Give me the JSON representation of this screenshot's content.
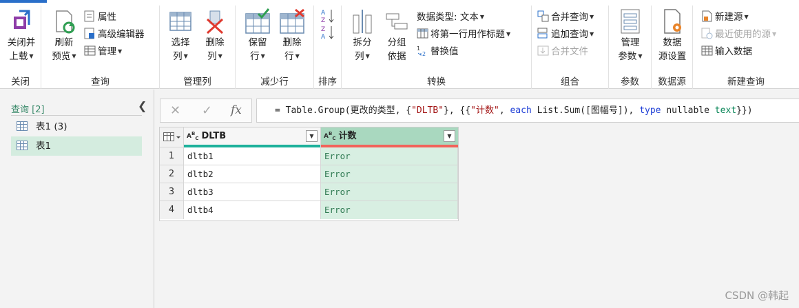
{
  "ribbon": {
    "groups": {
      "close": {
        "label": "关闭",
        "close_btn_line1": "关闭并",
        "close_btn_line2": "上载"
      },
      "query": {
        "label": "查询",
        "refresh_line1": "刷新",
        "refresh_line2": "预览",
        "properties": "属性",
        "advanced_editor": "高级编辑器",
        "manage": "管理"
      },
      "manage_columns": {
        "label": "管理列",
        "choose_line1": "选择",
        "choose_line2": "列",
        "remove_line1": "删除",
        "remove_line2": "列"
      },
      "reduce_rows": {
        "label": "减少行",
        "keep_line1": "保留",
        "keep_line2": "行",
        "remove_line1": "删除",
        "remove_line2": "行"
      },
      "sort": {
        "label": "排序"
      },
      "transform": {
        "label": "转换",
        "split_line1": "拆分",
        "split_line2": "列",
        "group_line1": "分组",
        "group_line2": "依据",
        "data_type": "数据类型: 文本",
        "first_row_header": "将第一行用作标题",
        "replace_values": "替换值"
      },
      "combine": {
        "label": "组合",
        "merge_queries": "合并查询",
        "append_queries": "追加查询",
        "combine_files": "合并文件"
      },
      "parameters": {
        "label": "参数",
        "manage_line1": "管理",
        "manage_line2": "参数"
      },
      "data_source": {
        "label": "数据源",
        "settings_line1": "数据",
        "settings_line2": "源设置"
      },
      "new_query": {
        "label": "新建查询",
        "new_source": "新建源",
        "recent_sources": "最近使用的源",
        "enter_data": "输入数据"
      }
    }
  },
  "queries_pane": {
    "header": "查询 [2]",
    "items": [
      {
        "label": "表1 (3)",
        "selected": false
      },
      {
        "label": "表1",
        "selected": true
      }
    ]
  },
  "formula_bar": {
    "fx": "fx",
    "p1": "= Table.Group(更改的类型, {",
    "s1": "\"DLTB\"",
    "p2": "}, {{",
    "s2": "\"计数\"",
    "p3": ", ",
    "k1": "each",
    "p4": " List.Sum([图幅号]), ",
    "k2": "type",
    "p5": " nullable ",
    "k3": "text",
    "p6": "}})"
  },
  "grid": {
    "columns": [
      {
        "name": "DLTB",
        "type_icon": "ABC",
        "quality_color": "#1db19b"
      },
      {
        "name": "计数",
        "type_icon": "ABC",
        "quality_color": "#f2625a"
      }
    ],
    "rows": [
      {
        "num": "1",
        "dltb": "dltb1",
        "count": "Error"
      },
      {
        "num": "2",
        "dltb": "dltb2",
        "count": "Error"
      },
      {
        "num": "3",
        "dltb": "dltb3",
        "count": "Error"
      },
      {
        "num": "4",
        "dltb": "dltb4",
        "count": "Error"
      }
    ]
  },
  "watermark": "CSDN @韩起",
  "colors": {
    "accent": "#2a6fc9",
    "selected_query": "#d4ecdf",
    "error_cell": "#d8efe2"
  }
}
